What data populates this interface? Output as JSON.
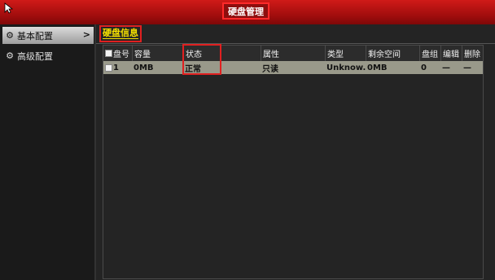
{
  "window": {
    "title": "硬盘管理"
  },
  "sidebar": {
    "items": [
      {
        "label": "基本配置",
        "icon": "gear-icon",
        "active": true
      },
      {
        "label": "高级配置",
        "icon": "gears-icon",
        "active": false
      }
    ],
    "arrow": ">"
  },
  "tabs": [
    {
      "label": "硬盘信息"
    }
  ],
  "table": {
    "columns": [
      "盘号",
      "容量",
      "状态",
      "属性",
      "类型",
      "剩余空间",
      "盘组",
      "编辑",
      "删除"
    ],
    "rows": [
      {
        "id": "1",
        "capacity": "0MB",
        "status": "正常",
        "attribute": "只读",
        "type": "Unknow...",
        "free": "0MB",
        "group": "0",
        "edit": "—",
        "delete": "—"
      }
    ]
  },
  "colors": {
    "titlebar": "#b01010",
    "highlight_box": "#e02020",
    "tab_text": "#f4e000",
    "row_bg": "#99998a"
  }
}
